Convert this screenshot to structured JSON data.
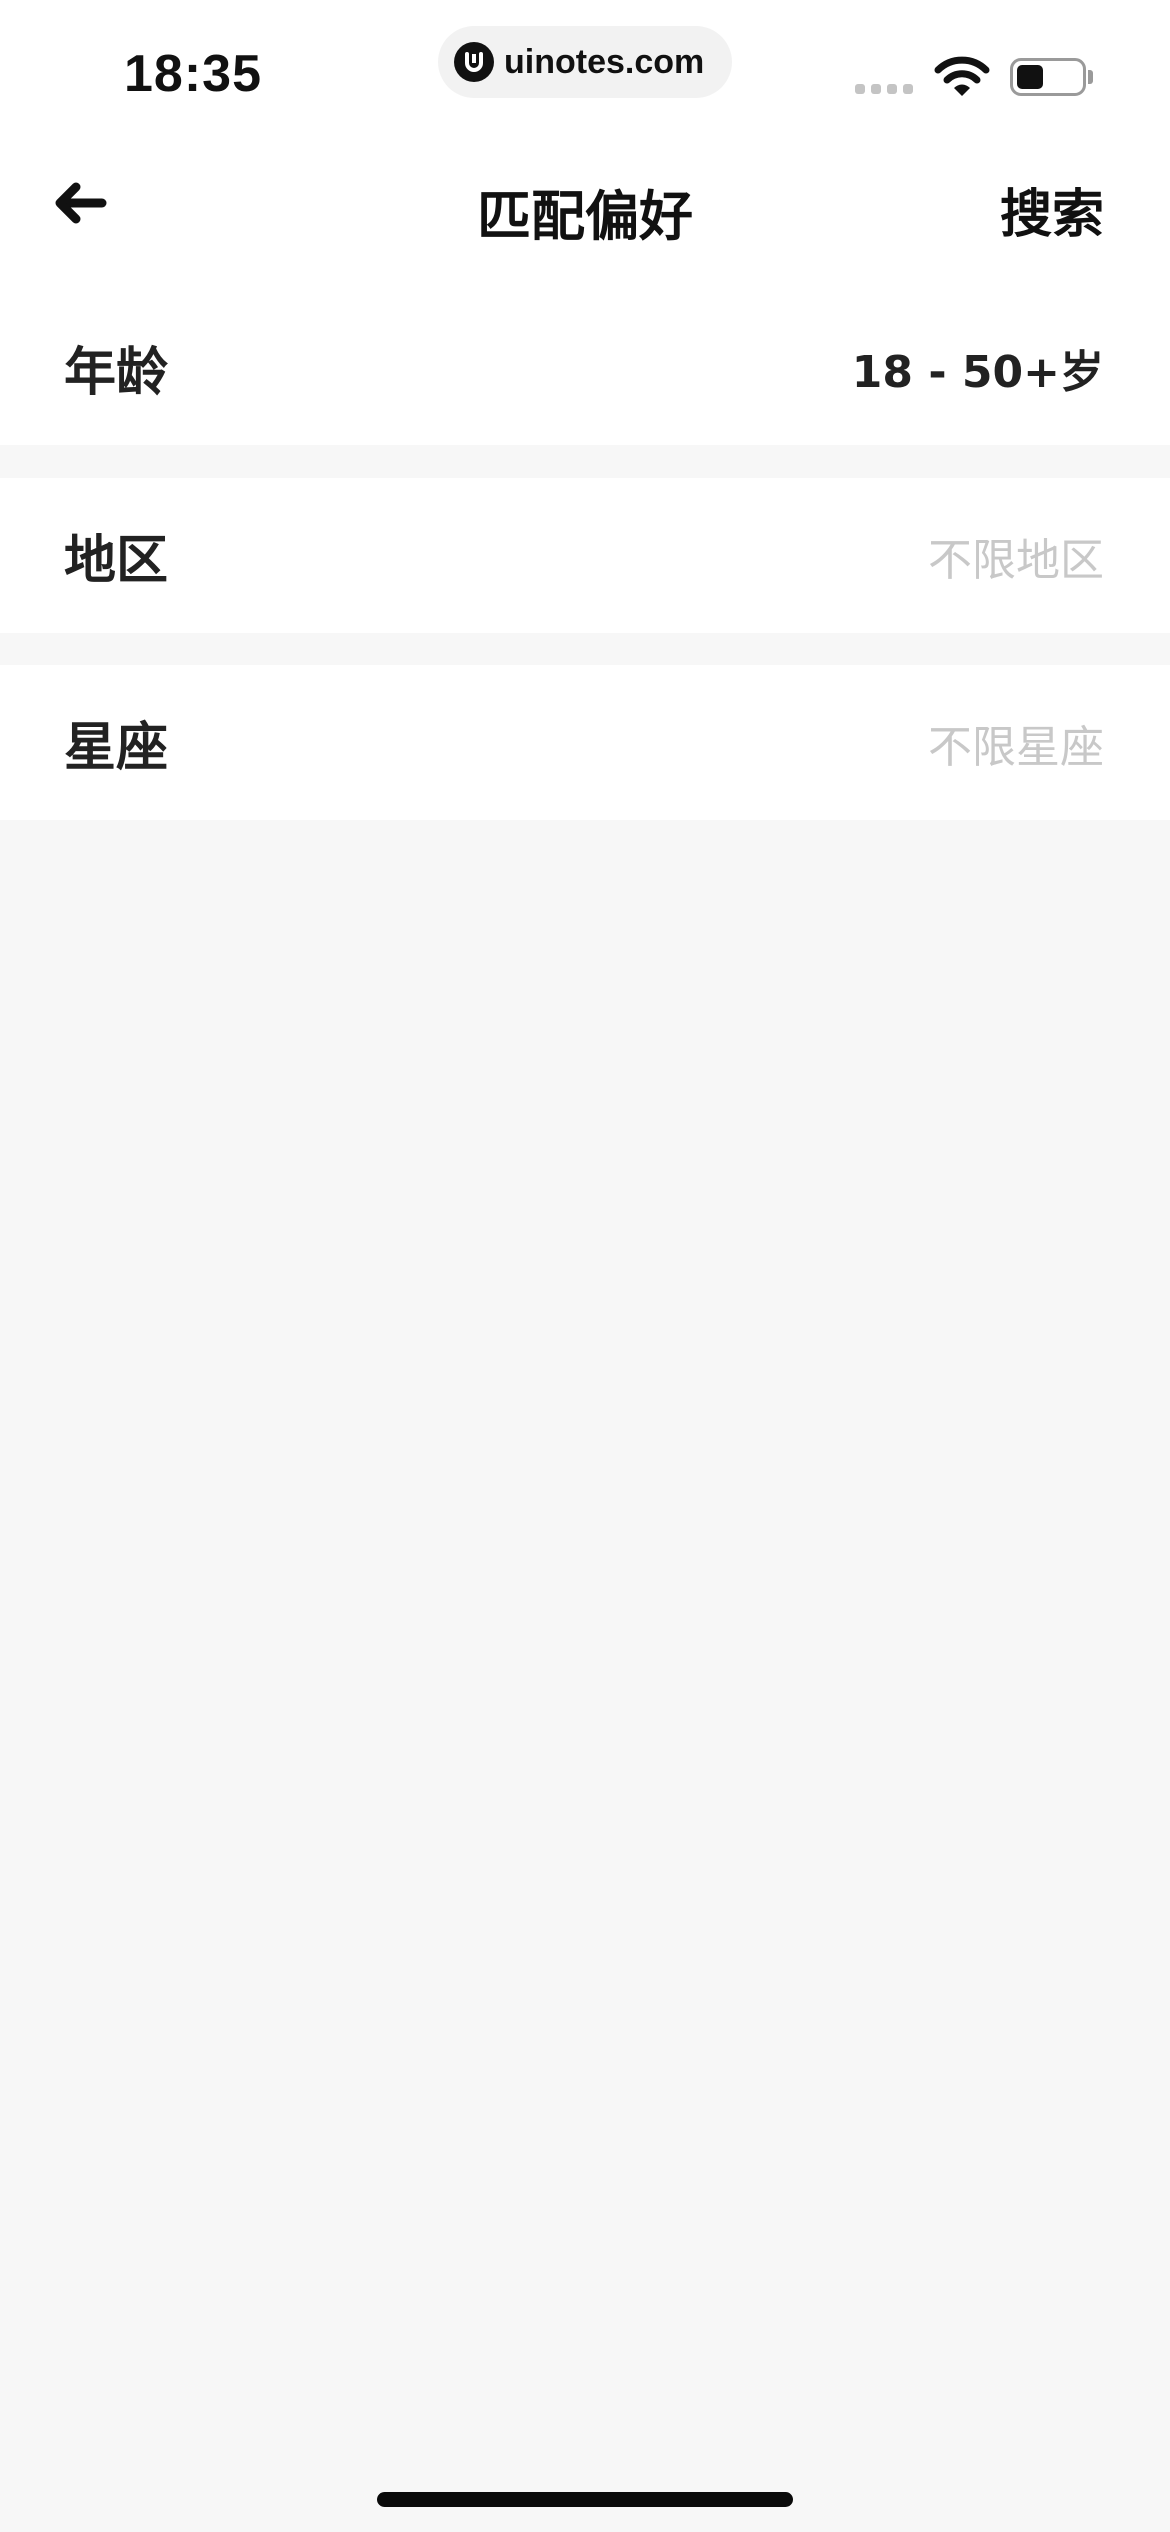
{
  "status_bar": {
    "time": "18:35",
    "url": "uinotes.com"
  },
  "nav": {
    "title": "匹配偏好",
    "search_label": "搜索",
    "back_icon": "arrow-left-icon"
  },
  "preferences": {
    "age": {
      "label": "年龄",
      "value": "18 - 50+岁"
    },
    "region": {
      "label": "地区",
      "value": "不限地区"
    },
    "zodiac": {
      "label": "星座",
      "value": "不限星座"
    }
  },
  "colors": {
    "background": "#f7f7f7",
    "row_background": "#ffffff",
    "text_primary": "#222222",
    "placeholder": "#c8c8c8"
  }
}
